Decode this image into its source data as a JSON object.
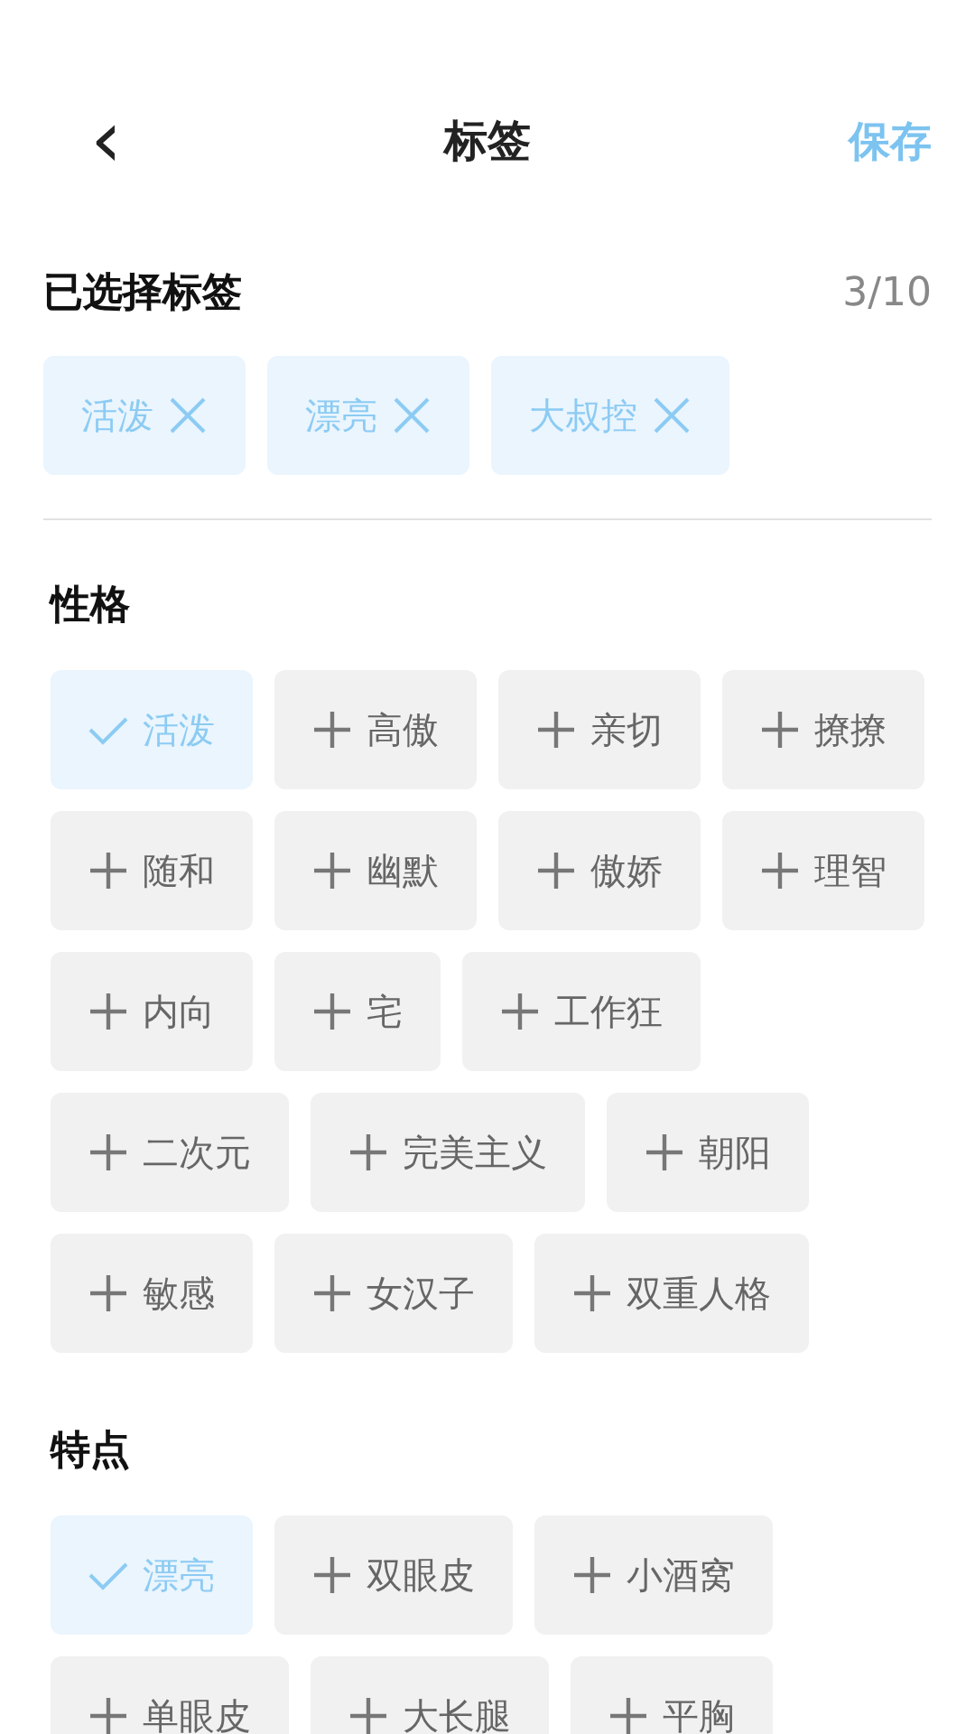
{
  "header": {
    "back": "‹",
    "title": "标签",
    "save": "保存"
  },
  "selected": {
    "title": "已选择标签",
    "count": "3/10",
    "tags": [
      {
        "label": "活泼"
      },
      {
        "label": "漂亮"
      },
      {
        "label": "大叔控"
      }
    ]
  },
  "groups": [
    {
      "title": "性格",
      "tags": [
        {
          "label": "活泼",
          "selected": true
        },
        {
          "label": "高傲",
          "selected": false
        },
        {
          "label": "亲切",
          "selected": false
        },
        {
          "label": "撩撩",
          "selected": false
        },
        {
          "label": "随和",
          "selected": false
        },
        {
          "label": "幽默",
          "selected": false
        },
        {
          "label": "傲娇",
          "selected": false
        },
        {
          "label": "理智",
          "selected": false
        },
        {
          "label": "内向",
          "selected": false
        },
        {
          "label": "宅",
          "selected": false
        },
        {
          "label": "工作狂",
          "selected": false
        },
        {
          "label": "二次元",
          "selected": false
        },
        {
          "label": "完美主义",
          "selected": false
        },
        {
          "label": "朝阳",
          "selected": false
        },
        {
          "label": "敏感",
          "selected": false
        },
        {
          "label": "女汉子",
          "selected": false
        },
        {
          "label": "双重人格",
          "selected": false
        }
      ]
    },
    {
      "title": "特点",
      "tags": [
        {
          "label": "漂亮",
          "selected": true
        },
        {
          "label": "双眼皮",
          "selected": false
        },
        {
          "label": "小酒窝",
          "selected": false
        },
        {
          "label": "单眼皮",
          "selected": false
        },
        {
          "label": "大长腿",
          "selected": false
        },
        {
          "label": "平胸",
          "selected": false
        }
      ]
    }
  ]
}
